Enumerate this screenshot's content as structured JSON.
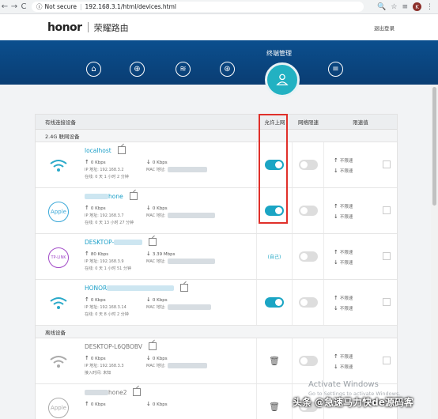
{
  "browser": {
    "security": "Not secure",
    "url": "192.168.3.1/html/devices.html",
    "avatar": "K"
  },
  "header": {
    "logo": "honor",
    "title": "荣耀路由",
    "logout": "退出登录"
  },
  "nav": {
    "active_title": "终端管理"
  },
  "table": {
    "col_device": "有线连接设备",
    "col_allow": "允许上网",
    "col_limit": "网络限速",
    "col_value": "限速值"
  },
  "section_24g": "2.4G 联网设备",
  "section_offline": "离线设备",
  "limits": {
    "up": "不限速",
    "down": "不限速"
  },
  "online_devices": [
    {
      "name": "localhost",
      "up": "0 Kbps",
      "down": "0 Kbps",
      "ip": "IP 地址: 192.168.3.2",
      "mac": "MAC 地址:",
      "online": "在线: 0 天 1 小时 2 分钟",
      "icon": "wifi-icon",
      "allow": "on"
    },
    {
      "name": "hone",
      "up": "0 Kbps",
      "down": "0 Kbps",
      "ip": "IP 地址: 192.168.3.7",
      "mac": "MAC 地址:",
      "online": "在线: 0 天 13 小时 27 分钟",
      "icon": "Apple",
      "allow": "on"
    },
    {
      "name": "DESKTOP-",
      "up": "80 Kbps",
      "down": "3.39 Mbps",
      "ip": "IP 地址: 192.168.3.9",
      "mac": "MAC 地址:",
      "online": "在线: 0 天 1 小时 51 分钟",
      "icon": "TP-LINK",
      "allow": "(自己)"
    },
    {
      "name": "HONOR",
      "up": "0 Kbps",
      "down": "0 Kbps",
      "ip": "IP 地址: 192.168.3.14",
      "mac": "MAC 地址:",
      "online": "在线: 0 天 8 小时 2 分钟",
      "icon": "wifi-icon",
      "allow": "on"
    }
  ],
  "offline_devices": [
    {
      "name": "DESKTOP-L6QBOBV",
      "up": "0 Kbps",
      "down": "0 Kbps",
      "ip": "IP 地址: 192.168.3.3",
      "mac": "MAC 地址:",
      "online": "接入时间: 未知",
      "icon": "wifi-icon"
    },
    {
      "name": "hone2",
      "up": "0 Kbps",
      "down": "0 Kbps",
      "icon": "Apple"
    }
  ],
  "watermark": {
    "line1": "Activate Windows",
    "line2": "Go to Settings to activate Windows.",
    "overlay": "头条 @急速马力快de源码客"
  }
}
